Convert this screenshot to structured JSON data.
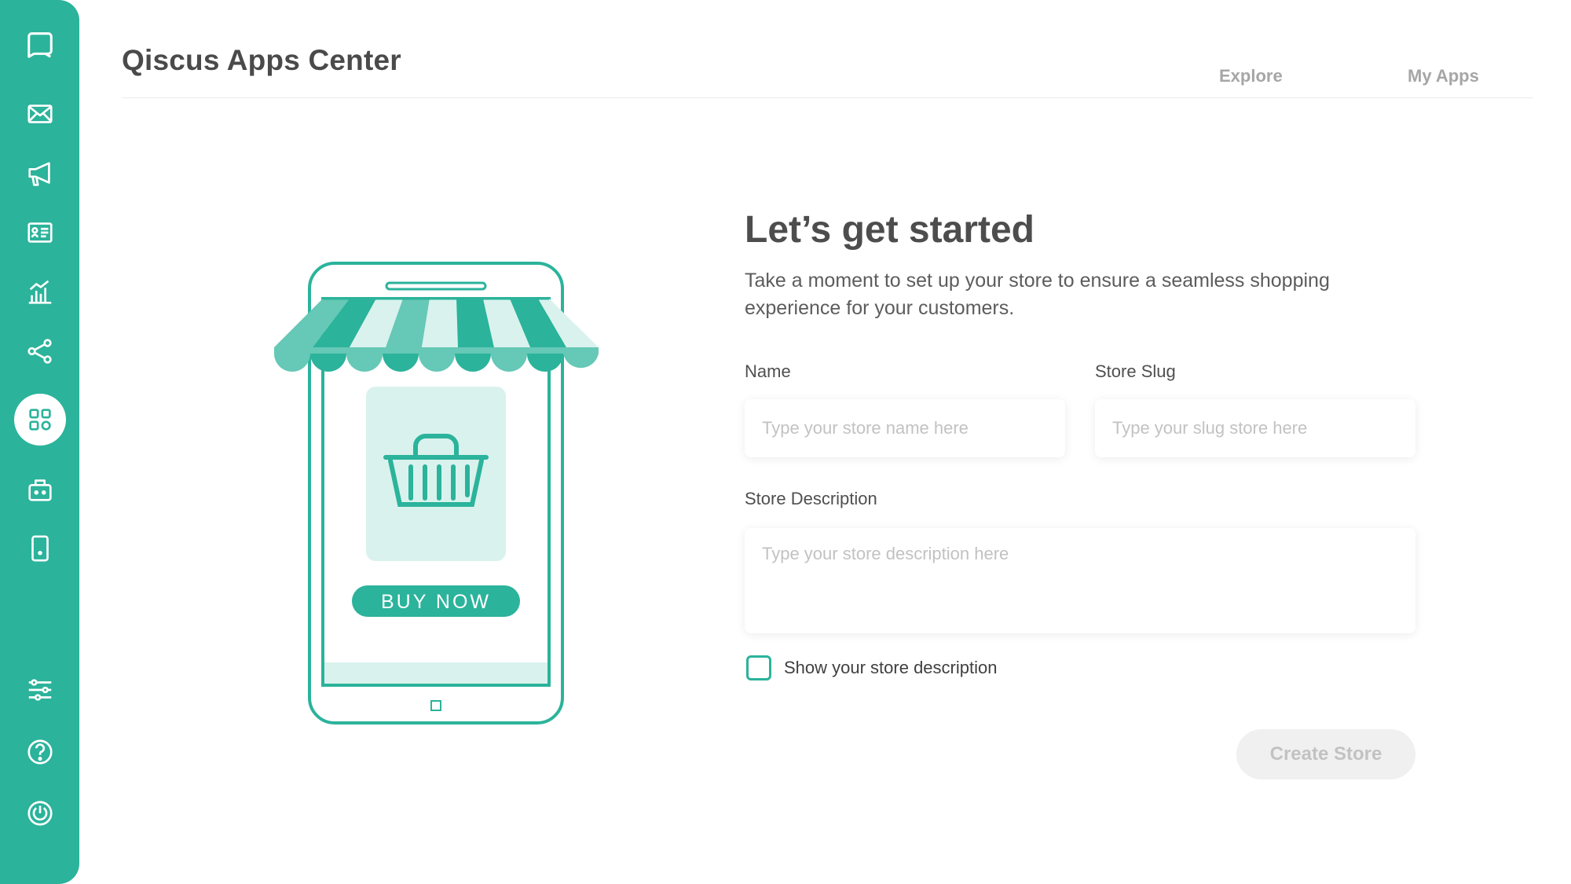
{
  "app": {
    "title": "Qiscus Apps Center"
  },
  "nav": {
    "explore": "Explore",
    "my_apps": "My Apps"
  },
  "sidebar": {
    "items": [
      {
        "icon": "chat-icon"
      },
      {
        "icon": "mail-icon"
      },
      {
        "icon": "megaphone-icon"
      },
      {
        "icon": "contact-card-icon"
      },
      {
        "icon": "analytics-icon"
      },
      {
        "icon": "share-nodes-icon"
      },
      {
        "icon": "apps-grid-icon",
        "active": true
      },
      {
        "icon": "bot-icon"
      },
      {
        "icon": "mobile-icon"
      },
      {
        "icon": "settings-sliders-icon"
      },
      {
        "icon": "help-icon"
      },
      {
        "icon": "power-icon"
      }
    ]
  },
  "illustration": {
    "button_text": "BUY NOW"
  },
  "form": {
    "title": "Let’s get started",
    "subtitle": "Take a moment to set up your store to ensure a seamless shopping experience for your customers.",
    "name_label": "Name",
    "name_placeholder": "Type your store name here",
    "slug_label": "Store Slug",
    "slug_placeholder": "Type your slug store here",
    "description_label": "Store Description",
    "description_placeholder": "Type your store description here",
    "show_description_label": "Show your store description",
    "show_description_checked": false,
    "submit_label": "Create Store"
  },
  "colors": {
    "brand": "#2bb39b",
    "brand_light": "#d9f2ed",
    "brand_mid": "#66c8b6",
    "text_dark": "#4d4d4d",
    "muted": "#a6a6a6"
  }
}
